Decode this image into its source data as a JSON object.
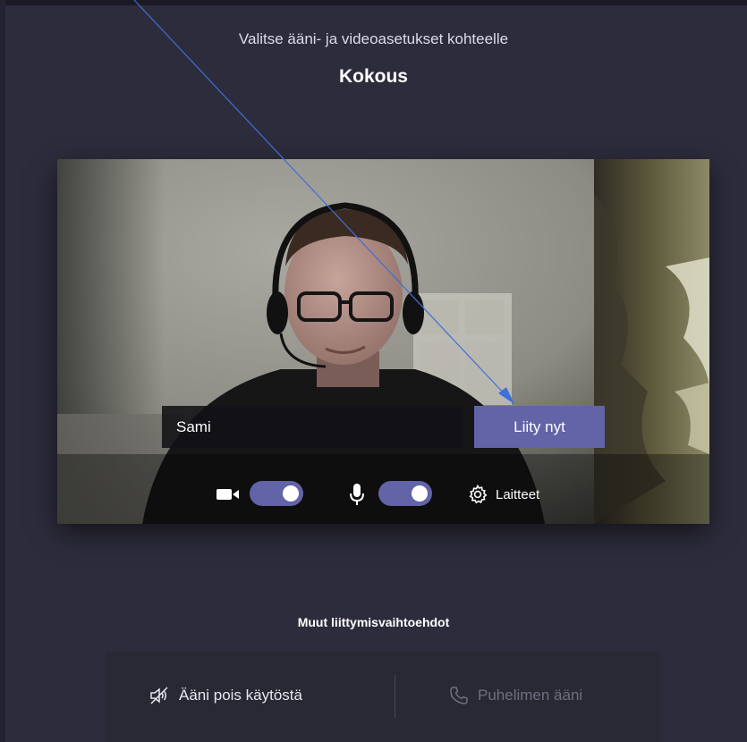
{
  "header": {
    "prompt": "Valitse ääni- ja videoasetukset kohteelle",
    "meeting_title": "Kokous"
  },
  "preview": {
    "name_value": "Sami",
    "join_label": "Liity nyt",
    "camera_on": true,
    "microphone_on": true,
    "devices_label": "Laitteet"
  },
  "other_options": {
    "title": "Muut liittymisvaihtoehdot",
    "audio_off_label": "Ääni pois käytöstä",
    "phone_audio_label": "Puhelimen ääni"
  },
  "colors": {
    "background": "#2d2c3c",
    "accent": "#6264a7",
    "annotation_arrow": "#3f6fd8"
  }
}
